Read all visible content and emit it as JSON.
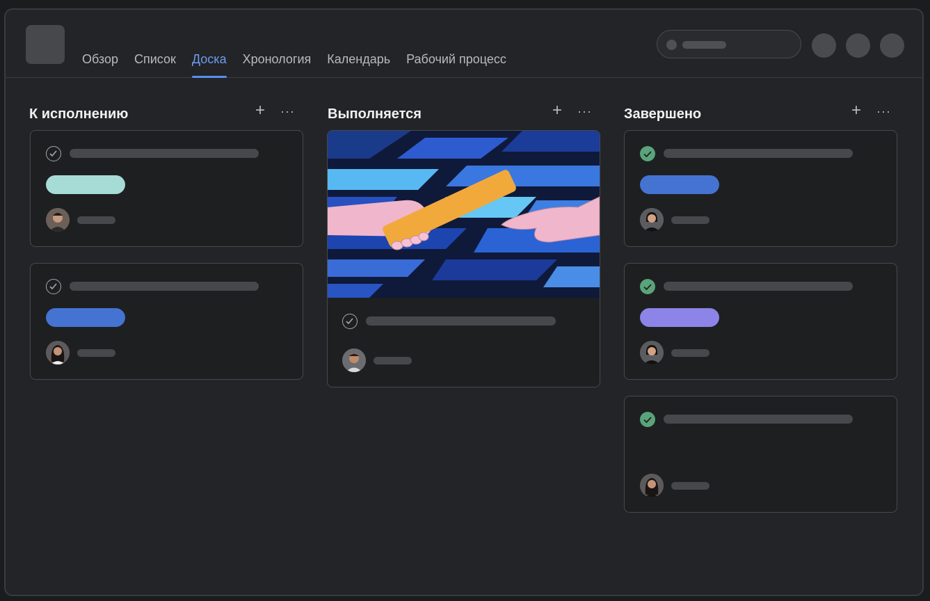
{
  "tabs": [
    {
      "label": "Обзор"
    },
    {
      "label": "Список"
    },
    {
      "label": "Доска",
      "active": true
    },
    {
      "label": "Хронология"
    },
    {
      "label": "Календарь"
    },
    {
      "label": "Рабочий процесс"
    }
  ],
  "columns": [
    {
      "title": "К исполнению"
    },
    {
      "title": "Выполняется"
    },
    {
      "title": "Завершено"
    }
  ],
  "icons": {
    "add": "+",
    "more": "···"
  },
  "colors": {
    "accent": "#5b8def",
    "tag_teal": "#a7dcd6",
    "tag_blue": "#4573d2",
    "tag_purple": "#8d84e8",
    "done_check": "#5aa47b"
  }
}
